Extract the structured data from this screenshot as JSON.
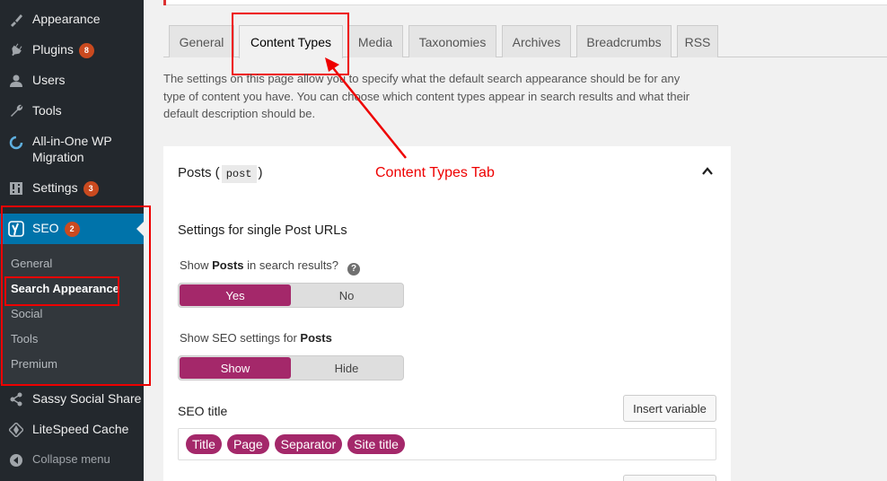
{
  "sidebar": {
    "items": [
      {
        "label": "Appearance",
        "icon": "paintbrush-icon"
      },
      {
        "label": "Plugins",
        "icon": "plug-icon",
        "badge": "8"
      },
      {
        "label": "Users",
        "icon": "user-icon"
      },
      {
        "label": "Tools",
        "icon": "wrench-icon"
      },
      {
        "label": "All-in-One WP\nMigration",
        "icon": "migration-icon"
      },
      {
        "label": "Settings",
        "icon": "settings-icon",
        "badge": "3"
      },
      {
        "label": "SEO",
        "icon": "yoast-icon",
        "badge": "2"
      },
      {
        "label": "Sassy Social Share",
        "icon": "share-icon"
      },
      {
        "label": "LiteSpeed Cache",
        "icon": "litespeed-icon"
      },
      {
        "label": "Collapse menu",
        "icon": "collapse-icon"
      }
    ],
    "seo_submenu": [
      "General",
      "Search Appearance",
      "Social",
      "Tools",
      "Premium"
    ]
  },
  "tabs": [
    "General",
    "Content Types",
    "Media",
    "Taxonomies",
    "Archives",
    "Breadcrumbs",
    "RSS"
  ],
  "active_tab": "Content Types",
  "description": "The settings on this page allow you to specify what the default search appearance should be for any type of content you have. You can choose which content types appear in search results and what their default description should be.",
  "panel": {
    "title": "Posts (",
    "title_code": "post",
    "title_end": ")",
    "section": "Settings for single Post URLs",
    "show_in_results_pre": "Show ",
    "show_in_results_bold": "Posts",
    "show_in_results_post": " in search results?",
    "help": "?",
    "toggle1": {
      "on": "Yes",
      "off": "No"
    },
    "show_seo_pre": "Show SEO settings for ",
    "show_seo_bold": "Posts",
    "toggle2": {
      "on": "Show",
      "off": "Hide"
    },
    "seo_title_label": "SEO title",
    "insert_variable": "Insert variable",
    "pills": [
      "Title",
      "Page",
      "Separator",
      "Site title"
    ]
  },
  "annotation": "Content Types Tab",
  "colors": {
    "sidebar_bg": "#23282d",
    "active_menu": "#0073aa",
    "yoast_purple": "#a4286a",
    "annotation_red": "#e00000"
  }
}
